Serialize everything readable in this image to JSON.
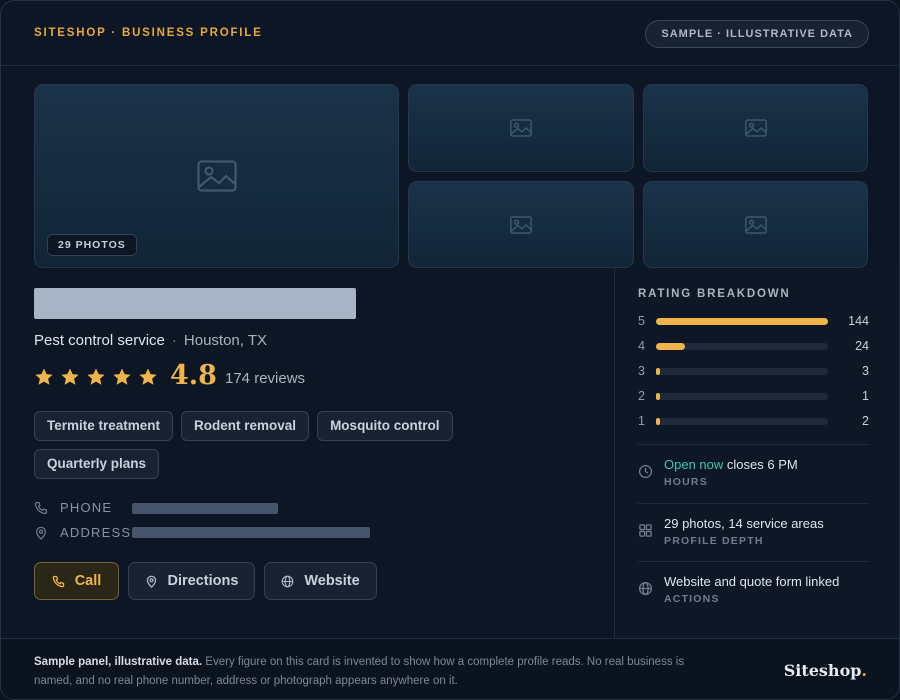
{
  "header": {
    "brand_line": "SITESHOP · BUSINESS PROFILE",
    "sample_pill": "SAMPLE · ILLUSTRATIVE DATA"
  },
  "gallery": {
    "photos_badge": "29 PHOTOS",
    "tile_icon": "image-placeholder-icon"
  },
  "business": {
    "category": "Pest control service",
    "separator": "·",
    "location": "Houston, TX",
    "rating": "4.8",
    "stars_filled": 5,
    "reviews": "174 reviews",
    "services": [
      "Termite treatment",
      "Rodent removal",
      "Mosquito control",
      "Quarterly plans"
    ]
  },
  "contact": {
    "phone_label": "PHONE",
    "address_label": "ADDRESS"
  },
  "actions": {
    "call": "Call",
    "directions": "Directions",
    "website": "Website"
  },
  "rating_breakdown": {
    "title": "RATING BREAKDOWN",
    "rows": [
      {
        "stars": "5",
        "count": 144
      },
      {
        "stars": "4",
        "count": 24
      },
      {
        "stars": "3",
        "count": 3
      },
      {
        "stars": "2",
        "count": 1
      },
      {
        "stars": "1",
        "count": 2
      }
    ]
  },
  "stats": {
    "hours_open": "Open now",
    "hours_close": "closes 6 PM",
    "hours_label": "HOURS",
    "depth_value": "29 photos, 14 service areas",
    "depth_label": "PROFILE DEPTH",
    "actions_value": "Website and quote form linked",
    "actions_label": "ACTIONS"
  },
  "footer": {
    "lead": "Sample panel, illustrative data.",
    "body": "Every figure on this card is invented to show how a complete profile reads. No real business is named, and no real phone number, address or photograph appears anywhere on it.",
    "logo": "Siteshop",
    "logo_dot": "."
  },
  "colors": {
    "accent": "#f0b54a",
    "open": "#3fc8b6",
    "background": "#0d1624"
  }
}
